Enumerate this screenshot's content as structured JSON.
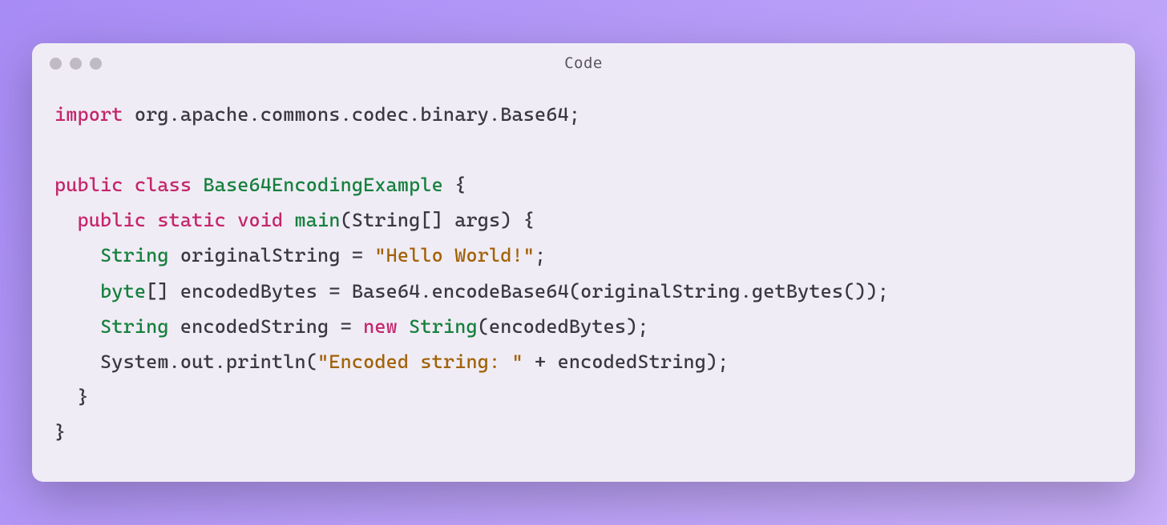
{
  "window": {
    "title": "Code"
  },
  "code": {
    "lines": [
      [
        {
          "cls": "tok-kw",
          "text": "import"
        },
        {
          "cls": "tok-plain",
          "text": " org.apache.commons.codec.binary.Base64;"
        }
      ],
      [
        {
          "cls": "tok-plain",
          "text": ""
        }
      ],
      [
        {
          "cls": "tok-kw",
          "text": "public"
        },
        {
          "cls": "tok-plain",
          "text": " "
        },
        {
          "cls": "tok-kw",
          "text": "class"
        },
        {
          "cls": "tok-plain",
          "text": " "
        },
        {
          "cls": "tok-ident",
          "text": "Base64EncodingExample"
        },
        {
          "cls": "tok-plain",
          "text": " {"
        }
      ],
      [
        {
          "cls": "tok-plain",
          "text": "  "
        },
        {
          "cls": "tok-kw",
          "text": "public"
        },
        {
          "cls": "tok-plain",
          "text": " "
        },
        {
          "cls": "tok-kw",
          "text": "static"
        },
        {
          "cls": "tok-plain",
          "text": " "
        },
        {
          "cls": "tok-kw",
          "text": "void"
        },
        {
          "cls": "tok-plain",
          "text": " "
        },
        {
          "cls": "tok-ident",
          "text": "main"
        },
        {
          "cls": "tok-plain",
          "text": "(String[] args) {"
        }
      ],
      [
        {
          "cls": "tok-plain",
          "text": "    "
        },
        {
          "cls": "tok-type",
          "text": "String"
        },
        {
          "cls": "tok-plain",
          "text": " originalString = "
        },
        {
          "cls": "tok-str",
          "text": "\"Hello World!\""
        },
        {
          "cls": "tok-plain",
          "text": ";"
        }
      ],
      [
        {
          "cls": "tok-plain",
          "text": "    "
        },
        {
          "cls": "tok-type",
          "text": "byte"
        },
        {
          "cls": "tok-plain",
          "text": "[] encodedBytes = Base64.encodeBase64(originalString.getBytes());"
        }
      ],
      [
        {
          "cls": "tok-plain",
          "text": "    "
        },
        {
          "cls": "tok-type",
          "text": "String"
        },
        {
          "cls": "tok-plain",
          "text": " encodedString = "
        },
        {
          "cls": "tok-kw",
          "text": "new"
        },
        {
          "cls": "tok-plain",
          "text": " "
        },
        {
          "cls": "tok-type",
          "text": "String"
        },
        {
          "cls": "tok-plain",
          "text": "(encodedBytes);"
        }
      ],
      [
        {
          "cls": "tok-plain",
          "text": "    System.out.println("
        },
        {
          "cls": "tok-str",
          "text": "\"Encoded string: \""
        },
        {
          "cls": "tok-plain",
          "text": " + encodedString);"
        }
      ],
      [
        {
          "cls": "tok-plain",
          "text": "  }"
        }
      ],
      [
        {
          "cls": "tok-plain",
          "text": "}"
        }
      ]
    ]
  }
}
